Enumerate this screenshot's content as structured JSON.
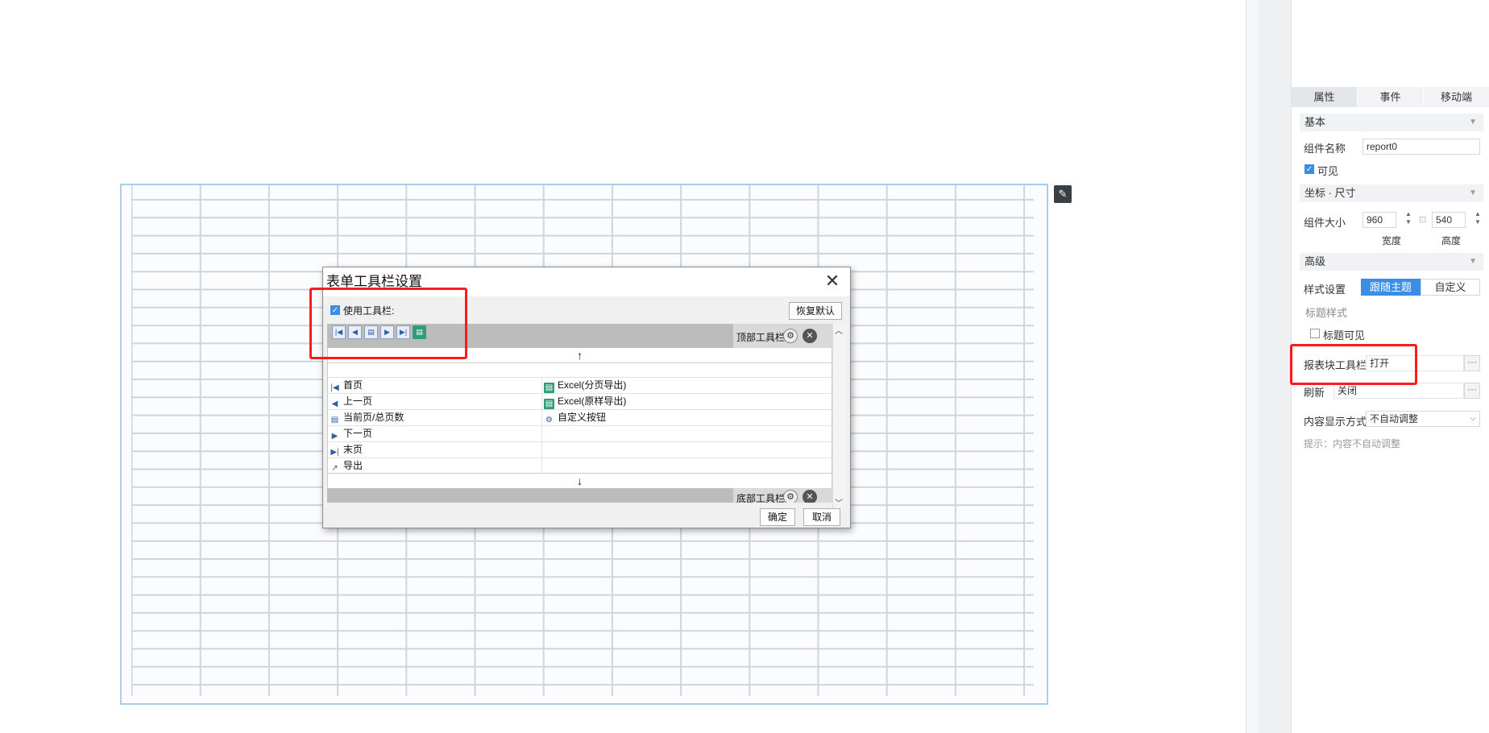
{
  "editor": {
    "edit_icon": "edit-icon"
  },
  "panel": {
    "tabs": [
      "属性",
      "事件",
      "移动端"
    ],
    "sections": {
      "basic": "基本",
      "coord": "坐标 · 尺寸",
      "advanced": "高级"
    },
    "component_name_label": "组件名称",
    "component_name_value": "report0",
    "visible_label": "可见",
    "size_label": "组件大小",
    "width_value": "960",
    "height_value": "540",
    "width_caption": "宽度",
    "height_caption": "高度",
    "style_label": "样式设置",
    "style_options": [
      "跟随主题",
      "自定义"
    ],
    "title_style_label": "标题样式",
    "title_visible_label": "标题可见",
    "toolbar_label": "报表块工具栏",
    "toolbar_value": "打开",
    "refresh_label": "刷新",
    "refresh_value": "关闭",
    "display_label": "内容显示方式",
    "display_value": "不自动调整",
    "hint": "提示：内容不自动调整",
    "more": "···"
  },
  "dialog": {
    "title": "表单工具栏设置",
    "use_toolbar_label": "使用工具栏:",
    "restore_default": "恢复默认",
    "top_bar_label": "顶部工具栏",
    "bottom_bar_label": "底部工具栏",
    "left_items": [
      {
        "icon": "first-page-icon",
        "glyph": "|◀",
        "label": "首页"
      },
      {
        "icon": "prev-page-icon",
        "glyph": "◀",
        "label": "上一页"
      },
      {
        "icon": "page-count-icon",
        "glyph": "▤",
        "label": "当前页/总页数"
      },
      {
        "icon": "next-page-icon",
        "glyph": "▶",
        "label": "下一页"
      },
      {
        "icon": "last-page-icon",
        "glyph": "▶|",
        "label": "末页"
      },
      {
        "icon": "export-icon",
        "glyph": "↗",
        "label": "导出"
      }
    ],
    "right_items": [
      {
        "icon": "excel-icon",
        "glyph": "▤",
        "label": "Excel(分页导出)"
      },
      {
        "icon": "excel-icon",
        "glyph": "▤",
        "label": "Excel(原样导出)"
      },
      {
        "icon": "gear-icon",
        "glyph": "⚙",
        "label": "自定义按钮"
      }
    ],
    "ok": "确定",
    "cancel": "取消",
    "up_arrow": "↑",
    "down_arrow": "↓"
  },
  "colors": {
    "accent": "#3a8ee6",
    "highlight": "#ff1a1a",
    "grid_line": "#cfd5db"
  }
}
